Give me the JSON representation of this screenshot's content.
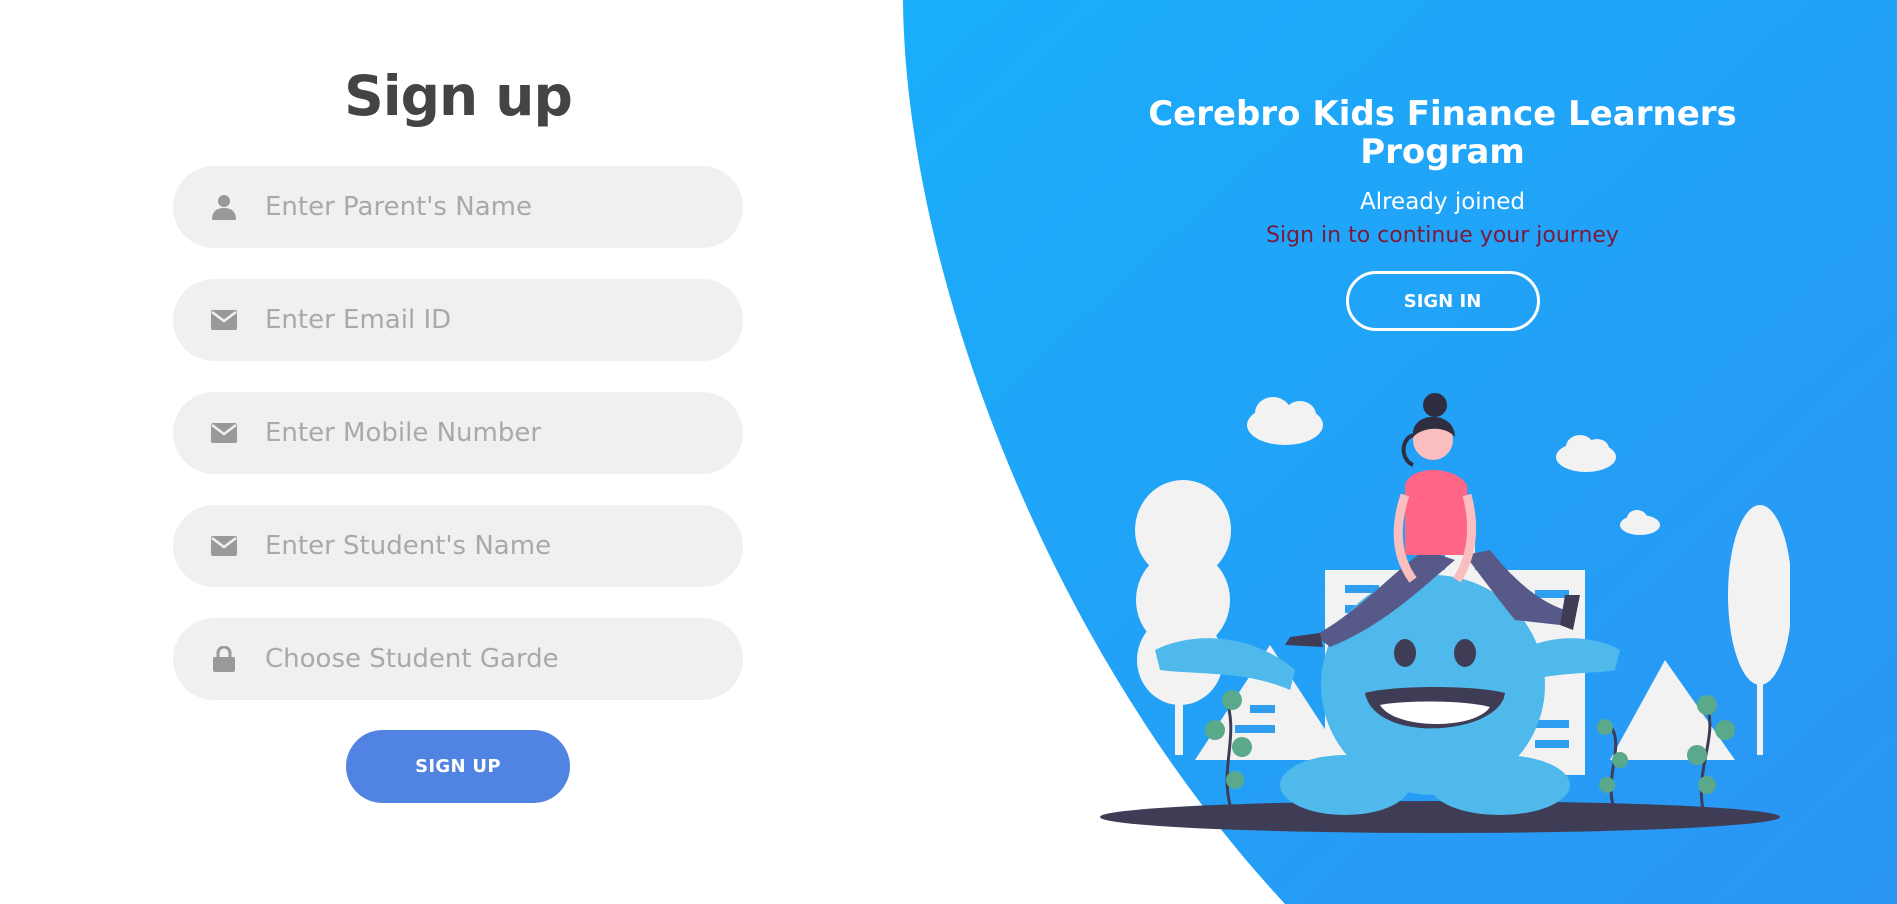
{
  "signup": {
    "title": "Sign up",
    "fields": [
      {
        "icon": "user-icon",
        "placeholder": "Enter Parent's Name"
      },
      {
        "icon": "envelope-icon",
        "placeholder": "Enter Email ID"
      },
      {
        "icon": "envelope-icon",
        "placeholder": "Enter Mobile Number"
      },
      {
        "icon": "envelope-icon",
        "placeholder": "Enter Student's Name"
      },
      {
        "icon": "lock-icon",
        "placeholder": "Choose Student Garde"
      }
    ],
    "button_label": "SIGN UP"
  },
  "signin_panel": {
    "program_title": "Cerebro Kids Finance Learners Program",
    "already_joined": "Already joined",
    "continue_text": "Sign in to continue your journey",
    "button_label": "SIGN IN"
  },
  "colors": {
    "panel_blue": "#1da7f8",
    "signup_button": "#5083e2",
    "field_bg": "#f0f0f0",
    "title_text": "#444444",
    "continue_text": "#7a1a3a"
  }
}
